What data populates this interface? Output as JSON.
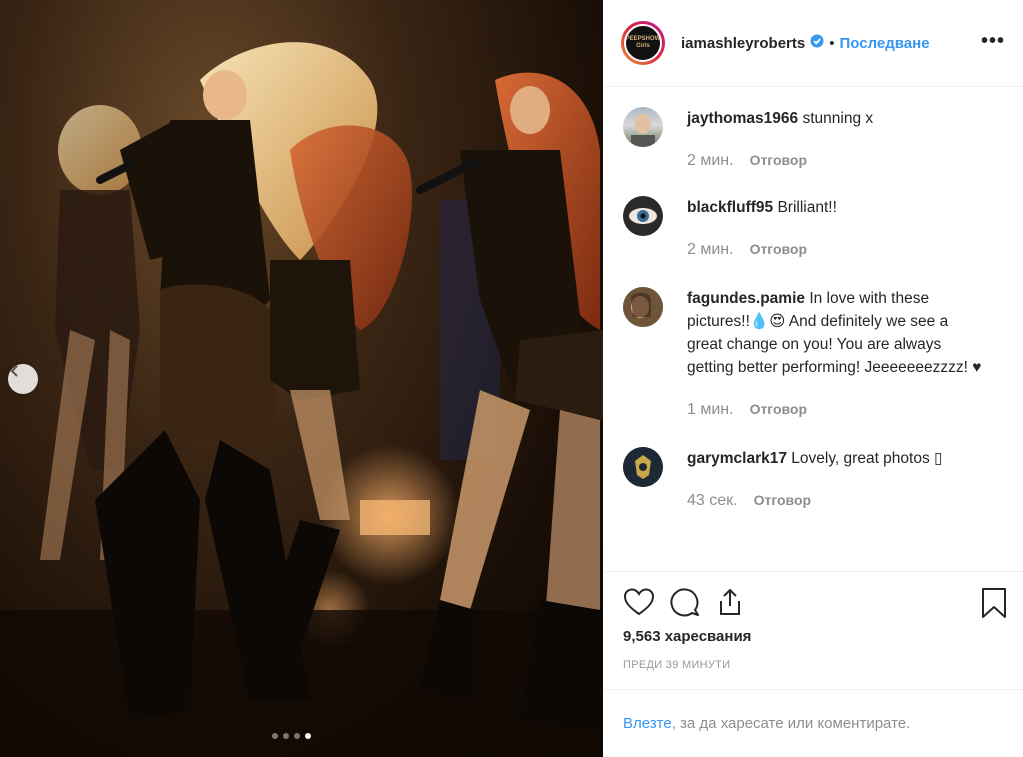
{
  "post": {
    "username": "iamashleyroberts",
    "verified": true,
    "follow_label": "Последване",
    "more_label": "•••",
    "avatar_text": "PEEPSHOW Girls"
  },
  "comments": [
    {
      "user": "jaythomas1966",
      "text": "stunning x",
      "time": "2 мин.",
      "reply": "Отговор"
    },
    {
      "user": "blackfluff95",
      "text": "Brilliant!!",
      "time": "2 мин.",
      "reply": "Отговор"
    },
    {
      "user": "fagundes.pamie",
      "text": "In love with these pictures!!💧😍 And definitely we see a great change on you! You are always getting better performing! Jeeeeeeezzzz! ♥",
      "time": "1 мин.",
      "reply": "Отговор"
    },
    {
      "user": "garymclark17",
      "text": "Lovely, great photos ▯",
      "time": "43 сек.",
      "reply": "Отговор"
    }
  ],
  "likes": "9,563 харесвания",
  "posted_ago": "ПРЕДИ 39 МИНУТИ",
  "login": {
    "link": "Влезте",
    "text": ", за да харесате или коментирате."
  },
  "carousel": {
    "count": 4,
    "active": 4
  },
  "colors": {
    "link": "#3897f0",
    "muted": "#8e8e8e",
    "text": "#262626"
  }
}
